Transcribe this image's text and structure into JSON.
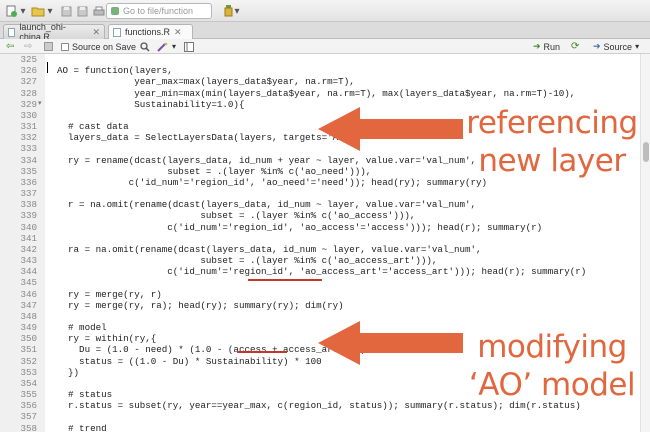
{
  "toolbar": {
    "goto_placeholder": "Go to file/function"
  },
  "tabs": [
    {
      "label": "launch_ohi-china.R",
      "active": false
    },
    {
      "label": "functions.R",
      "active": true
    }
  ],
  "editor_toolbar": {
    "source_on_save": "Source on Save",
    "run": "Run",
    "source": "Source"
  },
  "code_lines": [
    {
      "n": "325",
      "text": ""
    },
    {
      "n": "326",
      "text": "AO = function(layers,"
    },
    {
      "n": "327",
      "text": "              year_max=max(layers_data$year, na.rm=T),"
    },
    {
      "n": "328",
      "text": "              year_min=max(min(layers_data$year, na.rm=T), max(layers_data$year, na.rm=T)-10),"
    },
    {
      "n": "329",
      "text": "              Sustainability=1.0){"
    },
    {
      "n": "330",
      "text": ""
    },
    {
      "n": "331",
      "text": "  # cast data"
    },
    {
      "n": "332",
      "text": "  layers_data = SelectLayersData(layers, targets='AO')"
    },
    {
      "n": "333",
      "text": ""
    },
    {
      "n": "334",
      "text": "  ry = rename(dcast(layers_data, id_num + year ~ layer, value.var='val_num',"
    },
    {
      "n": "335",
      "text": "                    subset = .(layer %in% c('ao_need'))),"
    },
    {
      "n": "336",
      "text": "             c('id_num'='region_id', 'ao_need'='need')); head(ry); summary(ry)"
    },
    {
      "n": "337",
      "text": ""
    },
    {
      "n": "338",
      "text": "  r = na.omit(rename(dcast(layers_data, id_num ~ layer, value.var='val_num',"
    },
    {
      "n": "339",
      "text": "                          subset = .(layer %in% c('ao_access'))),"
    },
    {
      "n": "340",
      "text": "                    c('id_num'='region_id', 'ao_access'='access'))); head(r); summary(r)"
    },
    {
      "n": "341",
      "text": ""
    },
    {
      "n": "342",
      "text": "  ra = na.omit(rename(dcast(layers_data, id_num ~ layer, value.var='val_num',"
    },
    {
      "n": "343",
      "text": "                          subset = .(layer %in% c('ao_access_art'))),"
    },
    {
      "n": "344",
      "text": "                    c('id_num'='region_id', 'ao_access_art'='access_art'))); head(r); summary(r)"
    },
    {
      "n": "345",
      "text": ""
    },
    {
      "n": "346",
      "text": "  ry = merge(ry, r)"
    },
    {
      "n": "347",
      "text": "  ry = merge(ry, ra); head(ry); summary(ry); dim(ry)"
    },
    {
      "n": "348",
      "text": ""
    },
    {
      "n": "349",
      "text": "  # model"
    },
    {
      "n": "350",
      "text": "  ry = within(ry,{"
    },
    {
      "n": "351",
      "text": "    Du = (1.0 - need) * (1.0 - (access + access_art)/2 )"
    },
    {
      "n": "352",
      "text": "    status = ((1.0 - Du) * Sustainability) * 100"
    },
    {
      "n": "353",
      "text": "  })"
    },
    {
      "n": "354",
      "text": ""
    },
    {
      "n": "355",
      "text": "  # status"
    },
    {
      "n": "356",
      "text": "  r.status = subset(ry, year==year_max, c(region_id, status)); summary(r.status); dim(r.status)"
    },
    {
      "n": "357",
      "text": ""
    },
    {
      "n": "358",
      "text": "  # trend"
    }
  ],
  "annotations": {
    "top": {
      "line1": "referencing",
      "line2": "new layer"
    },
    "bottom": {
      "line1": "modifying",
      "line2": "‘AO’ model"
    },
    "color": "#e2663e"
  }
}
